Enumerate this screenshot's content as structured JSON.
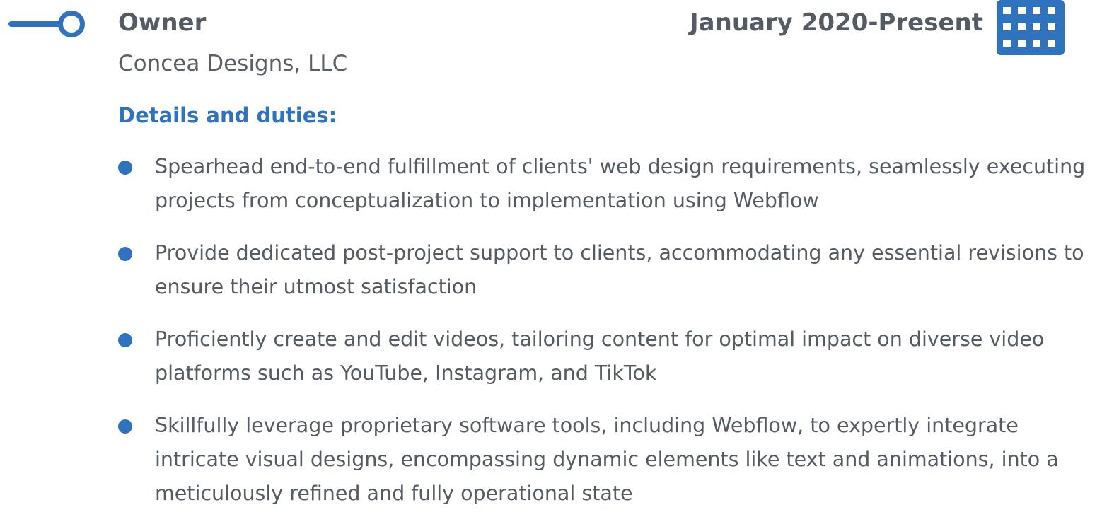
{
  "job": {
    "title": "Owner",
    "dates": "January 2020-Present",
    "company": "Concea Designs, LLC"
  },
  "details": {
    "heading": "Details and duties:",
    "duties": [
      "Spearhead end-to-end fulfillment of clients' web design requirements, seamlessly executing projects from conceptualization to implementation using Webflow",
      "Provide dedicated post-project support to clients, accommodating any essential revisions to ensure their utmost satisfaction",
      "Proficiently create and edit videos, tailoring content for optimal impact on diverse video platforms such as YouTube, Instagram, and TikTok",
      "Skillfully leverage proprietary software tools, including Webflow, to expertly integrate intricate visual designs, encompassing dynamic elements like text and animations, into a meticulously refined and fully operational state"
    ]
  },
  "icons": {
    "timeline": "timeline-node-icon",
    "calendar": "calendar-icon",
    "bullet": "bullet-icon"
  },
  "colors": {
    "accent": "#2f73bf",
    "text": "#555b64"
  }
}
